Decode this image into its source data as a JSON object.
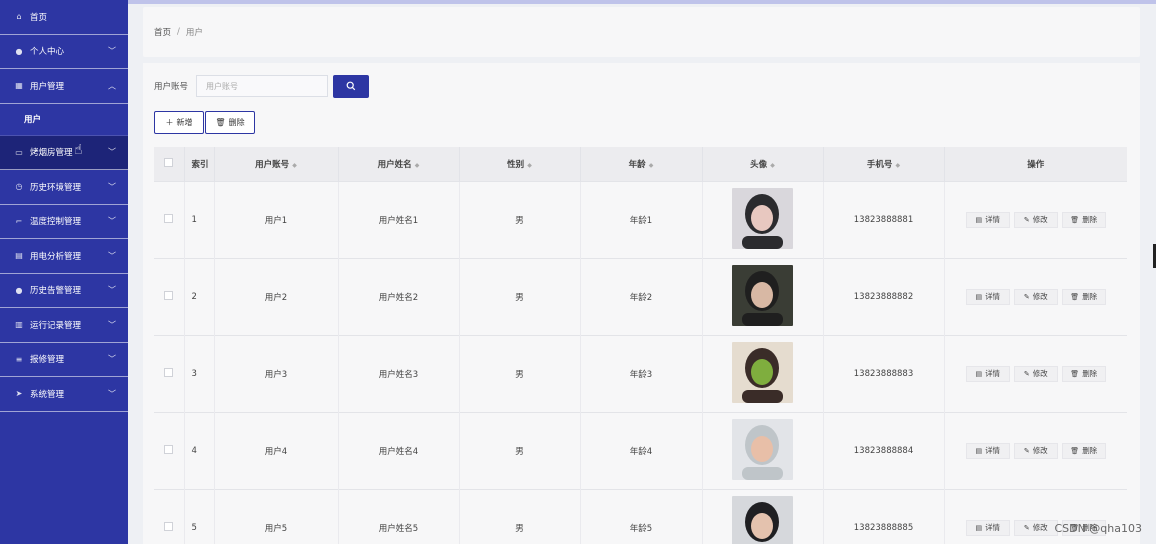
{
  "sidebar": {
    "items": [
      {
        "label": "首页",
        "icon": "home-icon",
        "glyph": "⌂",
        "chevron": false
      },
      {
        "label": "个人中心",
        "icon": "person-icon",
        "glyph": "●",
        "chevron": true
      },
      {
        "label": "用户管理",
        "icon": "grid-icon",
        "glyph": "▦",
        "chevron": true,
        "expanded": true
      },
      {
        "label": "用户",
        "submenu": true
      },
      {
        "label": "烤烟房管理",
        "icon": "chat-icon",
        "glyph": "▭",
        "chevron": true,
        "active": true
      },
      {
        "label": "历史环境管理",
        "icon": "clock-icon",
        "glyph": "◷",
        "chevron": true
      },
      {
        "label": "温度控制管理",
        "icon": "crop-icon",
        "glyph": "⌐",
        "chevron": true
      },
      {
        "label": "用电分析管理",
        "icon": "printer-icon",
        "glyph": "▤",
        "chevron": true
      },
      {
        "label": "历史告警管理",
        "icon": "person-icon",
        "glyph": "●",
        "chevron": true
      },
      {
        "label": "运行记录管理",
        "icon": "list-icon",
        "glyph": "▥",
        "chevron": true
      },
      {
        "label": "报修管理",
        "icon": "menu-icon",
        "glyph": "≡",
        "chevron": true
      },
      {
        "label": "系统管理",
        "icon": "send-icon",
        "glyph": "➤",
        "chevron": true
      }
    ]
  },
  "breadcrumb": {
    "home": "首页",
    "sep": "/",
    "current": "用户"
  },
  "search": {
    "label": "用户账号",
    "placeholder": "用户账号"
  },
  "actions": {
    "add": "新增",
    "delete": "删除"
  },
  "table": {
    "headers": [
      "索引",
      "用户账号",
      "用户姓名",
      "性别",
      "年龄",
      "头像",
      "手机号",
      "操作"
    ],
    "rows": [
      {
        "index": "1",
        "account": "用户1",
        "name": "用户姓名1",
        "gender": "男",
        "age": "年龄1",
        "phone": "13823888881",
        "avatar_colors": [
          "#d9d7dc",
          "#2b2b2e",
          "#e8c8c0"
        ]
      },
      {
        "index": "2",
        "account": "用户2",
        "name": "用户姓名2",
        "gender": "男",
        "age": "年龄2",
        "phone": "13823888882",
        "avatar_colors": [
          "#3a3d35",
          "#1f1f1f",
          "#d8b8a4"
        ]
      },
      {
        "index": "3",
        "account": "用户3",
        "name": "用户姓名3",
        "gender": "男",
        "age": "年龄3",
        "phone": "13823888883",
        "avatar_colors": [
          "#e5dccf",
          "#3a2c28",
          "#7fae3e"
        ]
      },
      {
        "index": "4",
        "account": "用户4",
        "name": "用户姓名4",
        "gender": "男",
        "age": "年龄4",
        "phone": "13823888884",
        "avatar_colors": [
          "#e2e4e8",
          "#bfc5c9",
          "#e8bfa8"
        ]
      },
      {
        "index": "5",
        "account": "用户5",
        "name": "用户姓名5",
        "gender": "男",
        "age": "年龄5",
        "phone": "13823888885",
        "avatar_colors": [
          "#d6d8dc",
          "#1f1f22",
          "#e4c2ae"
        ]
      }
    ],
    "ops": {
      "detail": "详情",
      "edit": "修改",
      "delete": "删除"
    }
  },
  "watermark": "CSDN @qha103",
  "colors": {
    "sidebar": "#2d36a3",
    "sidebar_active": "#1d2478",
    "accent": "#2d36a3"
  }
}
